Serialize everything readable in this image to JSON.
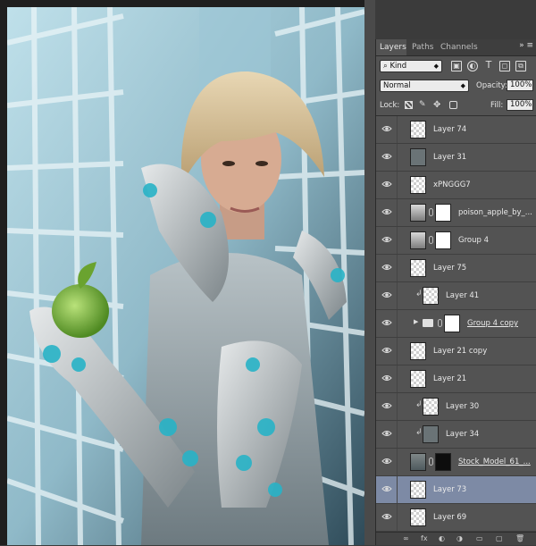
{
  "panel": {
    "tabs": [
      {
        "label": "Layers"
      },
      {
        "label": "Paths"
      },
      {
        "label": "Channels"
      }
    ],
    "menu_glyph": "»  ≡",
    "filter": {
      "label": "Kind",
      "icons": [
        "image-filter-icon",
        "adjustment-filter-icon",
        "type-filter-icon",
        "shape-filter-icon",
        "smart-object-filter-icon"
      ]
    },
    "blend_mode": "Normal",
    "opacity_label": "Opacity:",
    "opacity_value": "100%",
    "lock_label": "Lock:",
    "fill_label": "Fill:",
    "fill_value": "100%"
  },
  "layers": [
    {
      "name": "Layer 74",
      "thumb": "transparent"
    },
    {
      "name": "Layer 31",
      "thumb": "photo"
    },
    {
      "name": "xPNGGG7",
      "thumb": "transparent"
    },
    {
      "name": "poison_apple_by_...",
      "thumb": "apple",
      "mask": "white",
      "linked": true
    },
    {
      "name": "Group 4",
      "thumb": "apple",
      "mask": "white",
      "linked": true
    },
    {
      "name": "Layer 75",
      "thumb": "transparent"
    },
    {
      "name": "Layer 41",
      "thumb": "transparent",
      "clipped": true
    },
    {
      "name": "Group 4 copy",
      "thumb": "folder",
      "mask": "white",
      "linked": true,
      "underline": true
    },
    {
      "name": "Layer 21 copy",
      "thumb": "transparent"
    },
    {
      "name": "Layer 21",
      "thumb": "transparent"
    },
    {
      "name": "Layer 30",
      "thumb": "transparent",
      "clipped": true
    },
    {
      "name": "Layer 34",
      "thumb": "photo",
      "clipped": true
    },
    {
      "name": "Stock_Model_61_...",
      "thumb": "model",
      "mask": "black",
      "linked": true,
      "underline": true
    },
    {
      "name": "Layer 73",
      "thumb": "transparent",
      "selected": true
    },
    {
      "name": "Layer 69",
      "thumb": "transparent"
    }
  ],
  "footer": {
    "items": [
      "∞",
      "fx",
      "◐",
      "◑",
      "▭",
      "▢",
      "🗑"
    ]
  }
}
